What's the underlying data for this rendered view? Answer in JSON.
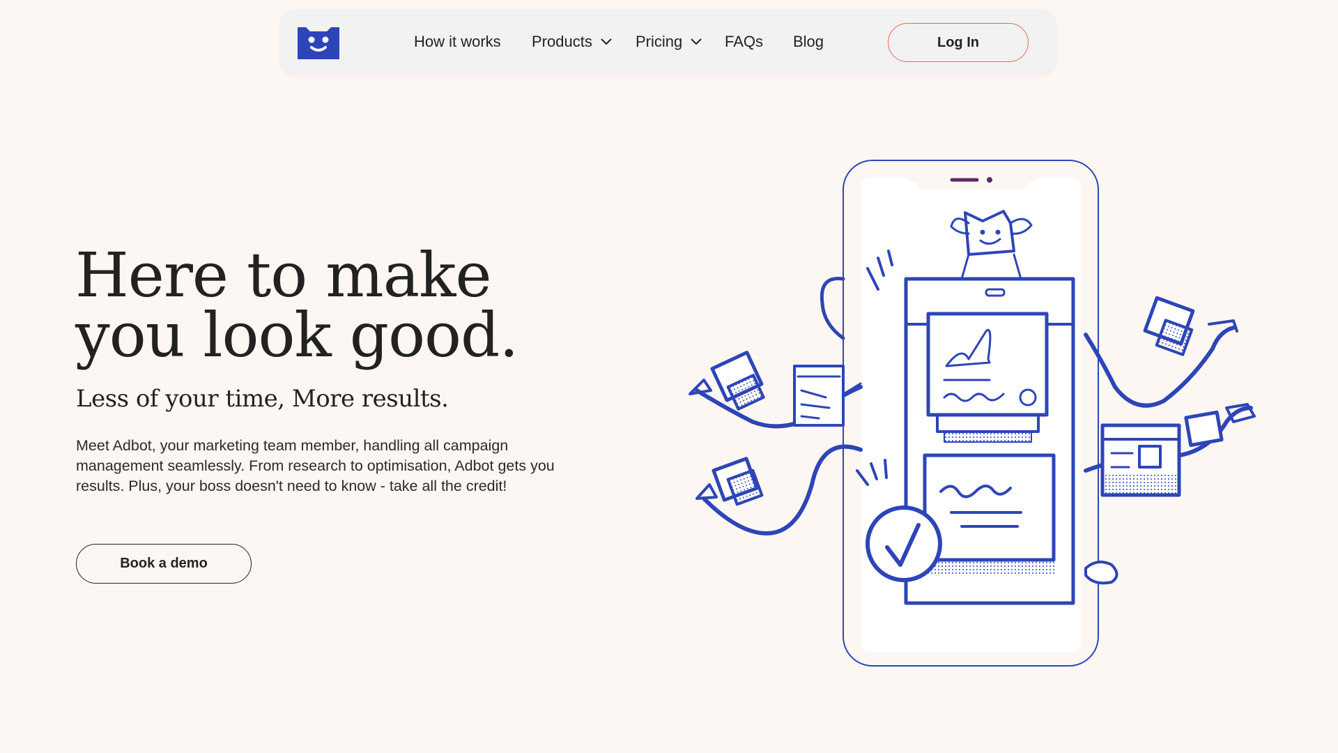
{
  "nav": {
    "logo_icon": "adbot-smiley-logo-icon",
    "items": [
      {
        "label": "How it works",
        "has_dropdown": false
      },
      {
        "label": "Products",
        "has_dropdown": true
      },
      {
        "label": "Pricing",
        "has_dropdown": true
      },
      {
        "label": "FAQs",
        "has_dropdown": false
      },
      {
        "label": "Blog",
        "has_dropdown": false
      }
    ],
    "login_label": "Log In"
  },
  "hero": {
    "title_line1": "Here to make",
    "title_line2": "you look good.",
    "subtitle": "Less of your time, More results.",
    "body": "Meet Adbot, your marketing team member, handling all campaign management seamlessly. From research to optimisation, Adbot gets you results. Plus, your boss doesn't need to know - take all the credit!",
    "cta_label": "Book a demo"
  },
  "colors": {
    "background": "#fdf7f3",
    "brand_blue": "#2d45b8",
    "login_border": "#e36b4f",
    "nav_bg": "#f2f2f2"
  }
}
